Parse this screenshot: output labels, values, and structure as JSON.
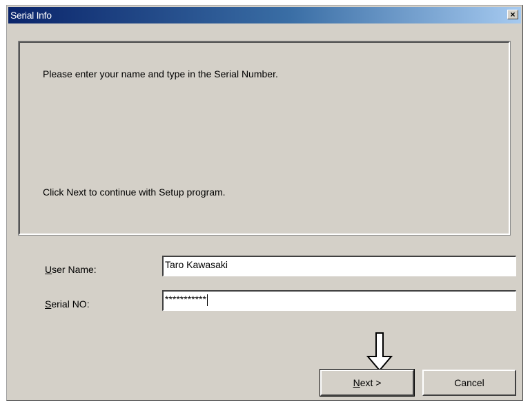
{
  "window": {
    "title": "Serial Info",
    "close_symbol": "×"
  },
  "info": {
    "line1": "Please enter your name and type in the Serial Number.",
    "line2": "Click Next to continue with Setup program."
  },
  "form": {
    "user_name_label_mnemonic": "U",
    "user_name_label_rest": "ser Name:",
    "user_name_value": "Taro Kawasaki",
    "serial_label_mnemonic": "S",
    "serial_label_rest": "erial NO:",
    "serial_value": "***********"
  },
  "buttons": {
    "next_mnemonic": "N",
    "next_rest": "ext >",
    "cancel_label": "Cancel"
  },
  "icons": {
    "pointer_arrow": "down-arrow-icon"
  }
}
